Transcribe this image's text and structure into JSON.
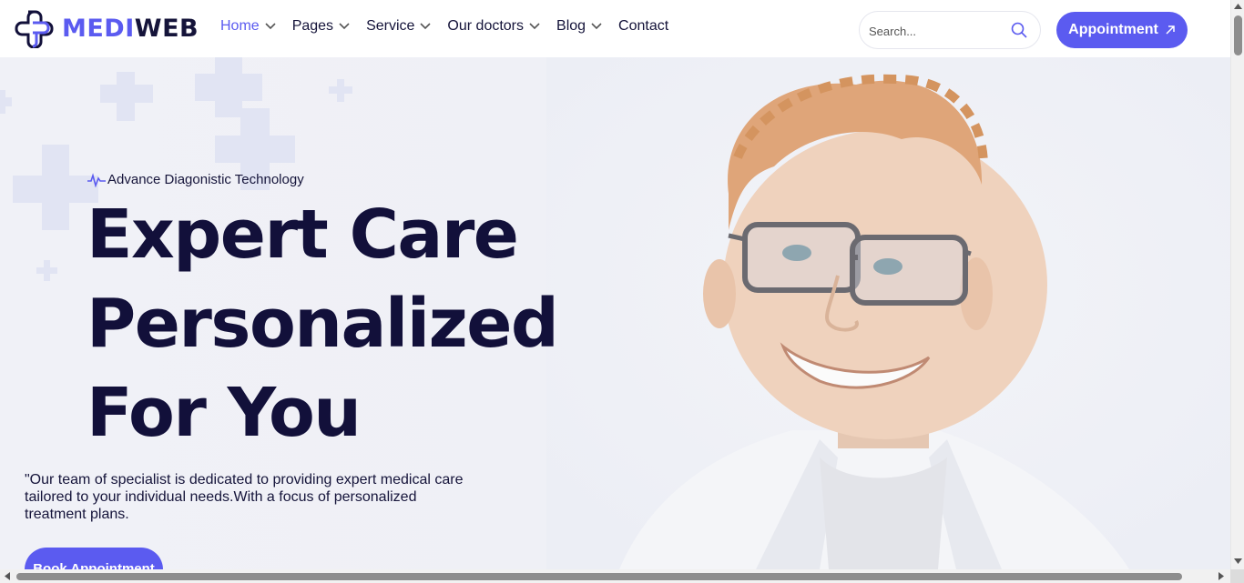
{
  "brand": {
    "name_part1": "MEDI",
    "name_part2": "WEB",
    "accent": "#5b5bf0",
    "dark": "#12103a"
  },
  "nav": {
    "items": [
      {
        "label": "Home",
        "dropdown": true,
        "active": true
      },
      {
        "label": "Pages",
        "dropdown": true
      },
      {
        "label": "Service",
        "dropdown": true
      },
      {
        "label": "Our doctors",
        "dropdown": true
      },
      {
        "label": "Blog",
        "dropdown": true
      },
      {
        "label": "Contact",
        "dropdown": false
      }
    ]
  },
  "search": {
    "placeholder": "Search...",
    "icon": "search-icon"
  },
  "appointment_button": {
    "label": "Appointment",
    "icon": "arrow-up-right-icon"
  },
  "hero": {
    "tagline": "Advance Diagonistic Technology",
    "tagline_icon": "heartbeat-icon",
    "headline": [
      "Expert Care",
      "Personalized",
      "For You"
    ],
    "description": "\"Our team of specialist is dedicated to providing expert medical care tailored to your individual needs.With a focus of personalized treatment plans.",
    "cta_label": "Book Appointment"
  }
}
